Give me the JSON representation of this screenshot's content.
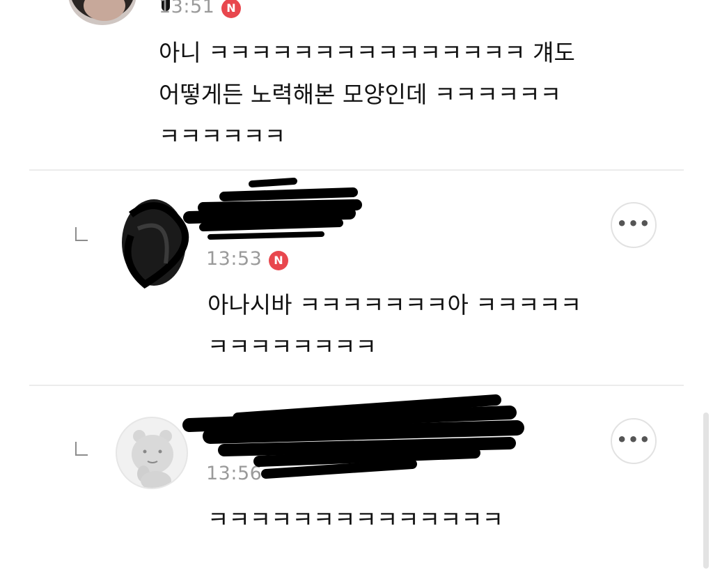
{
  "comments": [
    {
      "time": "13:51",
      "badge": "N",
      "lines": [
        "아니 ㅋㅋㅋㅋㅋㅋㅋㅋㅋㅋㅋㅋㅋㅋㅋ 걔도",
        "어떻게든 노력해본 모양인데 ㅋㅋㅋㅋㅋㅋ",
        "ㅋㅋㅋㅋㅋㅋ"
      ]
    },
    {
      "time": "13:53",
      "badge": "N",
      "more": "•••",
      "lines": [
        "아나시바 ㅋㅋㅋㅋㅋㅋㅋ아 ㅋㅋㅋㅋㅋ",
        "ㅋㅋㅋㅋㅋㅋㅋㅋ"
      ]
    },
    {
      "time": "13:56",
      "more": "•••",
      "lines": [
        "ㅋㅋㅋㅋㅋㅋㅋㅋㅋㅋㅋㅋㅋㅋ"
      ]
    }
  ],
  "icons": [
    "reply-indent-icon",
    "more-options-icon",
    "new-badge-icon",
    "avatar"
  ]
}
